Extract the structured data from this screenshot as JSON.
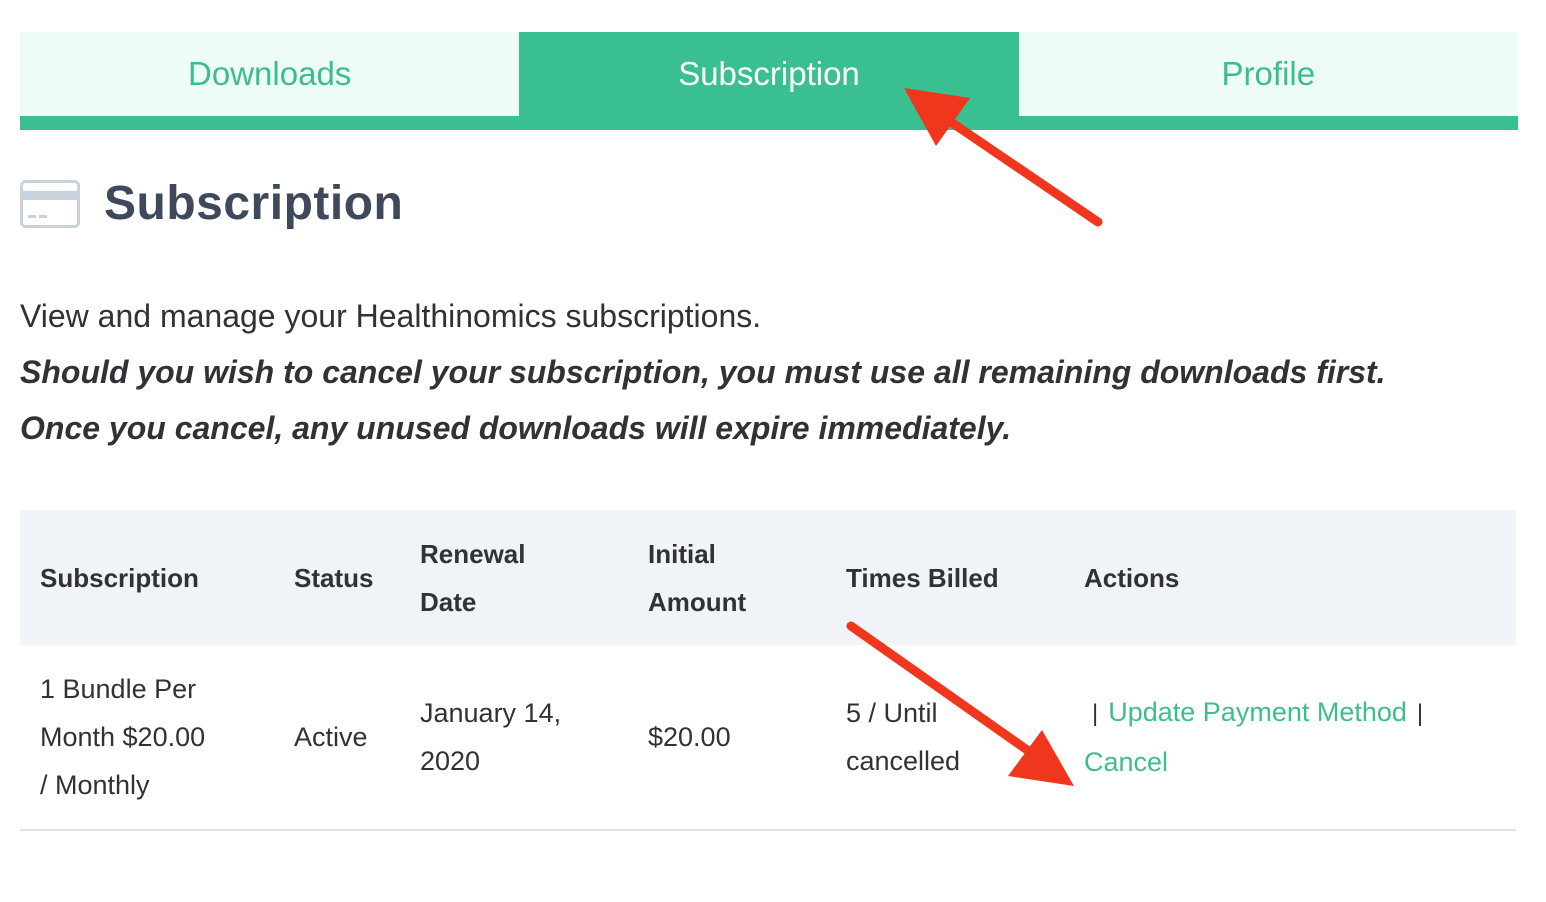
{
  "tabs": [
    {
      "label": "Downloads",
      "active": false
    },
    {
      "label": "Subscription",
      "active": true
    },
    {
      "label": "Profile",
      "active": false
    }
  ],
  "page": {
    "title": "Subscription",
    "icon": "credit-card-icon"
  },
  "intro": {
    "description": "View and manage your Healthinomics subscriptions.",
    "warning_line1": "Should you wish to cancel your subscription, you must use all remaining downloads first.",
    "warning_line2": "Once you cancel, any unused downloads will expire immediately."
  },
  "table": {
    "headers": {
      "subscription": "Subscription",
      "status": "Status",
      "renewal_date": "Renewal Date",
      "initial_amount": "Initial Amount",
      "times_billed": "Times Billed",
      "actions": "Actions"
    },
    "rows": [
      {
        "subscription": "1 Bundle Per Month $20.00 / Monthly",
        "status": "Active",
        "renewal_date": "January 14, 2020",
        "initial_amount": "$20.00",
        "times_billed": "5 / Until cancelled",
        "actions": {
          "separator": "|",
          "update_payment": "Update Payment Method",
          "cancel": "Cancel"
        }
      }
    ]
  },
  "colors": {
    "accent": "#3abf90",
    "tab_bg": "#eefcf6",
    "header_bg": "#f0f3f8",
    "annotation_arrow": "#f0361c"
  }
}
